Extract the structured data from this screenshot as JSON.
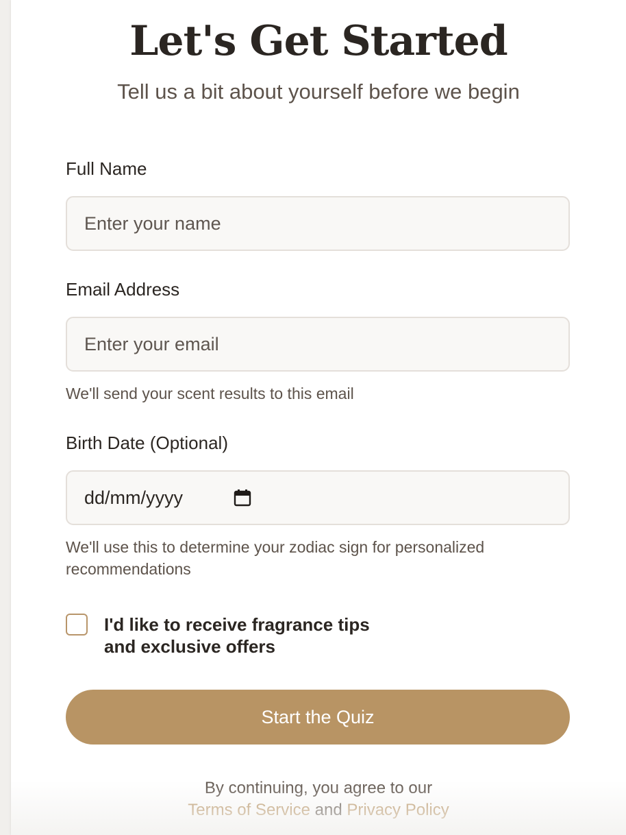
{
  "header": {
    "title": "Let's Get Started",
    "subtitle": "Tell us a bit about yourself before we begin"
  },
  "form": {
    "name": {
      "label": "Full Name",
      "placeholder": "Enter your name",
      "value": ""
    },
    "email": {
      "label": "Email Address",
      "placeholder": "Enter your email",
      "value": "",
      "hint": "We'll send your scent results to this email"
    },
    "birthdate": {
      "label": "Birth Date (Optional)",
      "placeholder": "dd/mm/yyyy",
      "icon": "calendar-icon",
      "hint": "We'll use this to determine your zodiac sign for personalized recommendations"
    },
    "opt_in": {
      "label": "I'd like to receive fragrance tips and exclusive offers",
      "checked": false
    },
    "submit_label": "Start the Quiz"
  },
  "legal": {
    "prefix": "By continuing, you agree to our",
    "terms": "Terms of Service",
    "and": "and",
    "privacy": "Privacy Policy"
  },
  "colors": {
    "accent": "#b89464",
    "text": "#2b2622",
    "muted": "#5d534b",
    "field_bg": "#f9f8f6",
    "field_border": "#e4dfda"
  }
}
